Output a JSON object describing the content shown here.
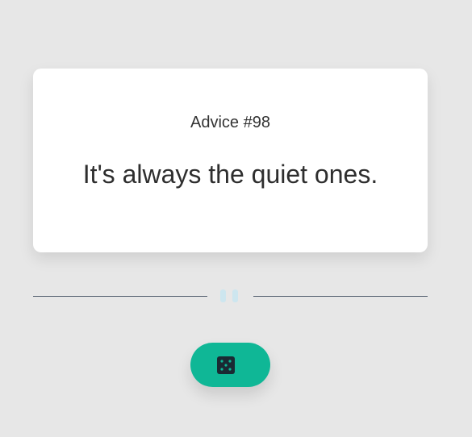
{
  "advice": {
    "number_label": "Advice #98",
    "text": "It's always the quiet ones."
  },
  "divider": {
    "icon": "pause-icon"
  },
  "actions": {
    "dice_icon": "dice-icon",
    "button_color": "#0fb796"
  },
  "colors": {
    "background": "#e7e7e7",
    "card": "#ffffff",
    "text": "#2e2e2e",
    "divider_line": "#4f5b6b",
    "pause_bars": "#cde6ef",
    "dice_face": "#1a2a33"
  }
}
